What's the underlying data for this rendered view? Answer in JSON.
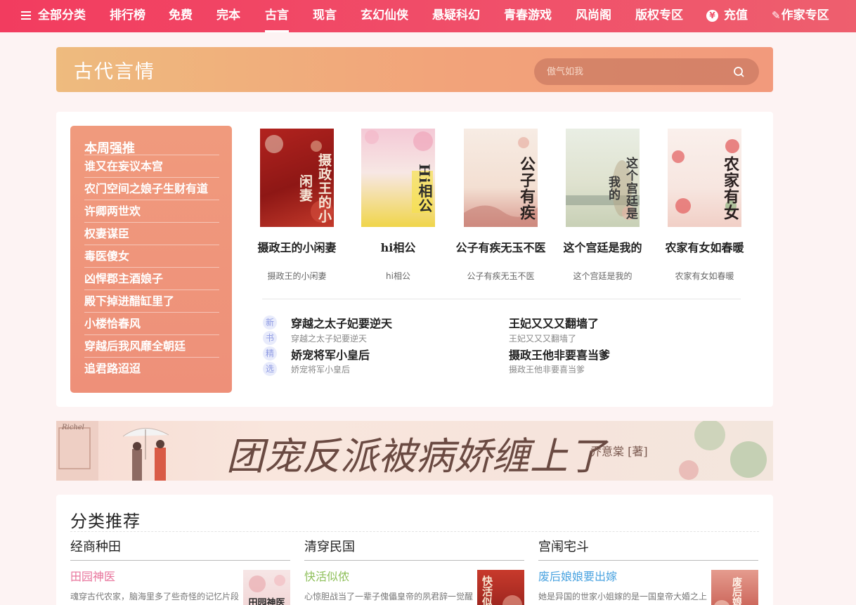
{
  "nav": {
    "all_categories": "全部分类",
    "items": [
      "排行榜",
      "免费",
      "完本",
      "古言",
      "现言",
      "玄幻仙侠",
      "悬疑科幻",
      "青春游戏",
      "风尚阁",
      "版权专区"
    ],
    "active": "古言",
    "recharge": "充值",
    "recharge_icon": "yen-coin-icon",
    "author_zone": "作家专区",
    "author_icon": "pen-icon"
  },
  "section": {
    "title": "古代言情",
    "search_placeholder": "傲气如我"
  },
  "weekly": {
    "title": "本周强推",
    "items": [
      "谁又在妄议本宫",
      "农门空间之娘子生财有道",
      "许卿两世欢",
      "权妻谋臣",
      "毒医傻女",
      "凶悍郡主酒娘子",
      "殿下掉进醋缸里了",
      "小楼恰春风",
      "穿越后我风靡全朝廷",
      "追君路迢迢"
    ]
  },
  "featured": [
    {
      "title": "摄政王的小闲妻",
      "sub": "摄政王的小闲妻",
      "cover_text": "摄政王的小闲妻"
    },
    {
      "title": "hi相公",
      "sub": "hi相公",
      "cover_text": "Hi相公"
    },
    {
      "title": "公子有疾无玉不医",
      "sub": "公子有疾无玉不医",
      "cover_text": "公子有疾"
    },
    {
      "title": "这个宫廷是我的",
      "sub": "这个宫廷是我的",
      "cover_text": "这个宫廷是我的"
    },
    {
      "title": "农家有女如春暖",
      "sub": "农家有女如春暖",
      "cover_text": "农家有女"
    }
  ],
  "picks": {
    "badges": [
      "新",
      "书",
      "精",
      "选"
    ],
    "items": [
      {
        "title": "穿越之太子妃要逆天",
        "desc": "穿越之太子妃要逆天"
      },
      {
        "title": "王妃又又又翻墙了",
        "desc": "王妃又又又翻墙了"
      },
      {
        "title": "娇宠将军小皇后",
        "desc": "娇宠将军小皇后"
      },
      {
        "title": "摄政王他非要喜当爹",
        "desc": "摄政王他非要喜当爹"
      }
    ]
  },
  "promo": {
    "title": "团宠反派被病娇缠上了",
    "author": "乔意棠 [著]",
    "sign": "Richel"
  },
  "categories": {
    "heading": "分类推荐",
    "columns": [
      {
        "name": "经商种田",
        "book_title": "田园神医",
        "desc": "魂穿古代农家，脑海里多了些奇怪的记忆片段",
        "color": "#e8739b",
        "cover_text": "田园神医"
      },
      {
        "name": "清穿民国",
        "book_title": "快活似侬",
        "desc": "心惊胆战当了一辈子傀儡皇帝的夙君辞一觉醒来",
        "color": "#8fc05b",
        "cover_text": "快活似侬"
      },
      {
        "name": "宫闱宅斗",
        "book_title": "废后娘娘要出嫁",
        "desc": "她是异国的世家小姐嫁的是一国皇帝大婚之上",
        "color": "#4aa3e0",
        "cover_text": "废后娘娘"
      }
    ]
  }
}
